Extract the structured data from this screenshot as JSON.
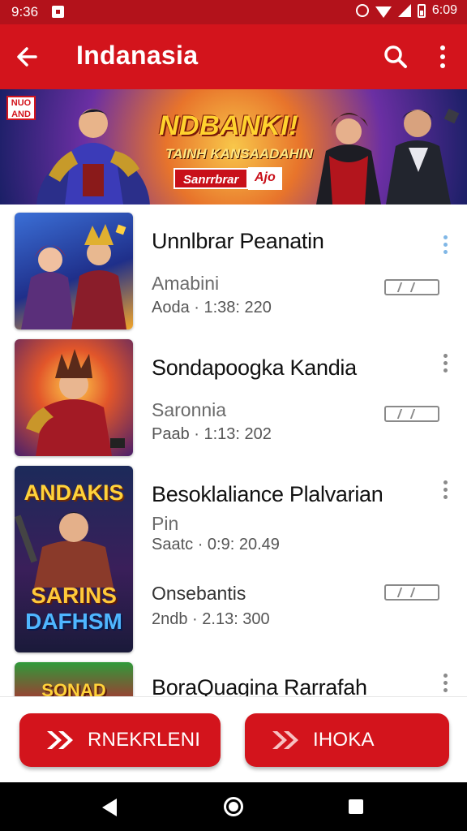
{
  "status_bar": {
    "time": "9:36",
    "clock": "6:09",
    "icons": [
      "notification-icon",
      "alarm-icon",
      "wifi-icon",
      "signal-icon",
      "battery-icon"
    ]
  },
  "app_bar": {
    "title": "Indanasia",
    "back_icon": "arrow-left-icon",
    "search_icon": "search-icon",
    "menu_icon": "more-vert-icon",
    "color": "#d3141c"
  },
  "banner": {
    "logo_text": "NUO AND",
    "headline": "NDBANKI!",
    "subline": "TAINH KANSAADAHIN",
    "tag": "Sanrrbrar",
    "tag_secondary": "Ajo"
  },
  "items": [
    {
      "name": "Unnlbrar Peanatin",
      "meta1": "Amabini",
      "meta2": "Aoda · 1:38: 220",
      "menu_highlight": true
    },
    {
      "name": "Sondapoogka Kandia",
      "meta1": "Saronnia",
      "meta2": "Paab · 1:13: 202",
      "menu_highlight": false
    },
    {
      "name": "Besoklaliance Plalvarian",
      "meta1": "Pin",
      "meta2": "Saatc · 0:9: 20.49",
      "meta3": "Onsebantis",
      "meta4": "2ndb · 2.13: 300",
      "thumb_title_top": "ANDAKIS",
      "thumb_title_mid": "SARINS",
      "thumb_title_bot": "DAFHSM",
      "menu_highlight": false
    },
    {
      "name": "BoraQuagina Rarrafah",
      "thumb_title_top": "SONAD",
      "menu_highlight": false
    }
  ],
  "actions": {
    "left_label": "RNEKRLENI",
    "right_label": "IHOKA",
    "icon": "double-chevron-right-icon"
  },
  "nav": {
    "icons": [
      "nav-back-icon",
      "nav-home-icon",
      "nav-recents-icon"
    ]
  }
}
